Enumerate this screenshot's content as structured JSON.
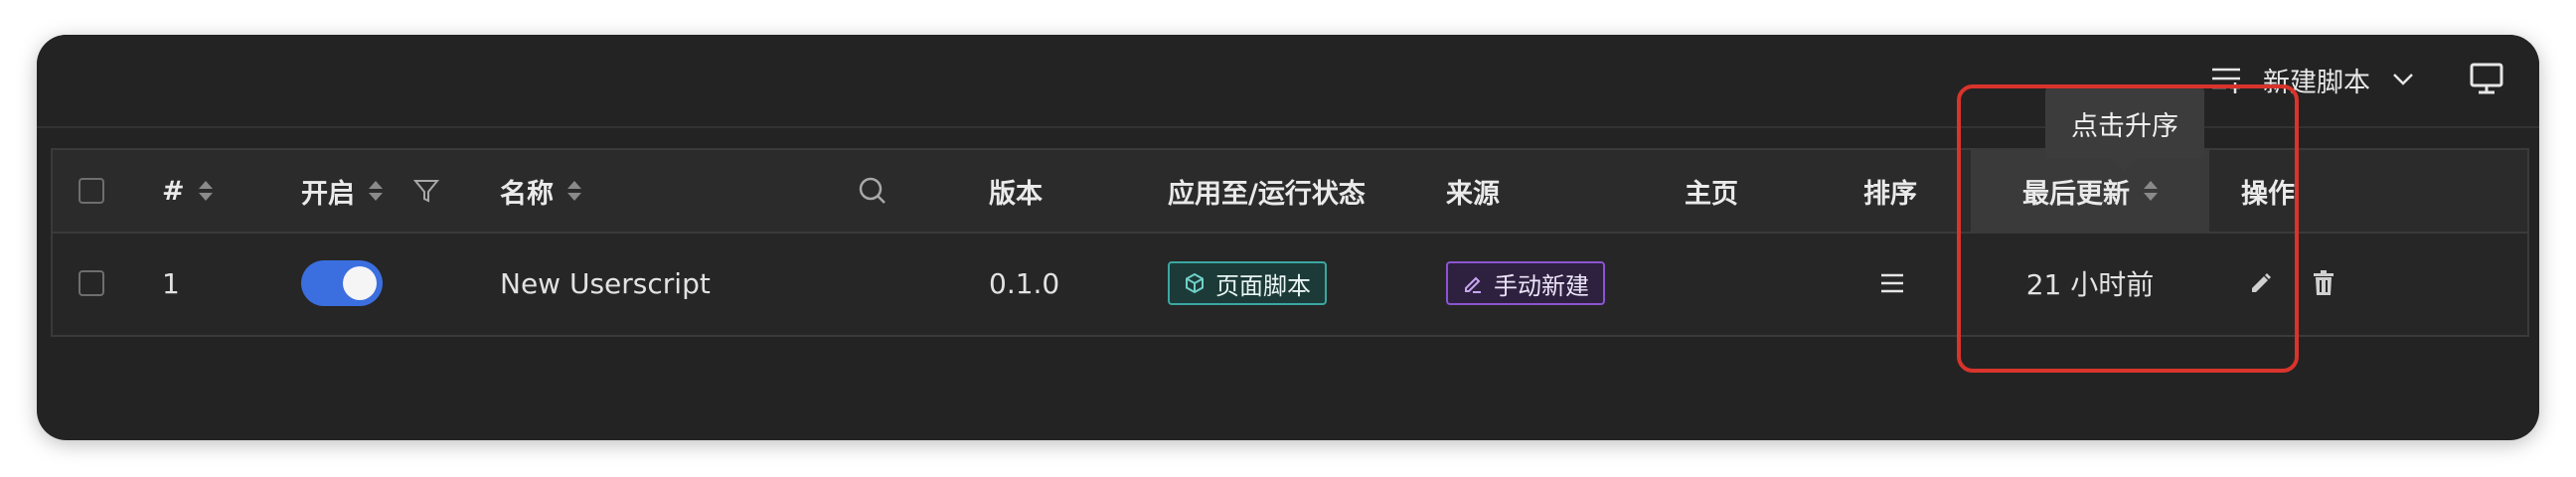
{
  "header": {
    "new_script_label": "新建脚本",
    "sort_list_icon": "sort-list-icon",
    "monitor_icon": "monitor-icon"
  },
  "table": {
    "columns": {
      "num": "#",
      "enabled": "开启",
      "name": "名称",
      "version": "版本",
      "apply_status": "应用至/运行状态",
      "source": "来源",
      "homepage": "主页",
      "order": "排序",
      "last_updated": "最后更新",
      "actions": "操作"
    },
    "rows": [
      {
        "num": "1",
        "enabled": true,
        "name": "New Userscript",
        "version": "0.1.0",
        "apply_tag": "页面脚本",
        "source_tag": "手动新建",
        "homepage": "",
        "last_updated": "21 小时前"
      }
    ]
  },
  "tooltip": {
    "text": "点击升序"
  },
  "colors": {
    "accent": "#3b6fe0",
    "tag_cyan": "#3aa7a1",
    "tag_purple": "#8a55d0",
    "highlight_red": "#d8342c"
  }
}
